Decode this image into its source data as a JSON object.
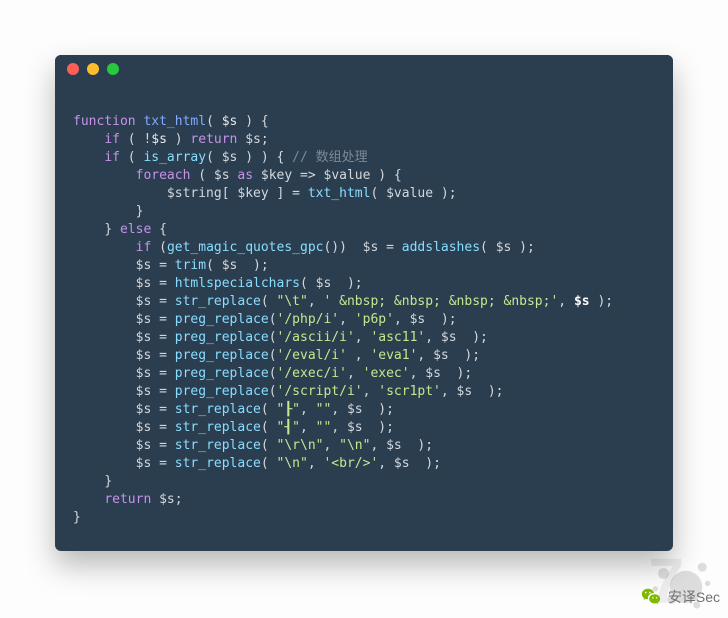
{
  "titlebar": {
    "close": "close",
    "minimize": "minimize",
    "zoom": "zoom"
  },
  "code": {
    "l1": {
      "kw_func": "function",
      "fname": "txt_html",
      "sig_open": "( ",
      "arg": "$s",
      "sig_close": " ) {"
    },
    "l2": {
      "indent": "    ",
      "kw_if": "if",
      "cond_open": " ( !",
      "var": "$s",
      "cond_close": " ) ",
      "kw_ret": "return",
      "ret_tail": " $s;"
    },
    "l3": {
      "indent": "    ",
      "kw_if": "if",
      "open": " ( ",
      "fn": "is_array",
      "args": "( $s ) ) { ",
      "cmt": "// 数组处理"
    },
    "l4": {
      "indent": "        ",
      "kw_foreach": "foreach",
      "open": " ( $s ",
      "kw_as": "as",
      "mid": " $key => $value ) {"
    },
    "l5": {
      "indent": "            ",
      "lhs": "$string[ $key ] = ",
      "fn": "txt_html",
      "args": "( $value );"
    },
    "l6": {
      "indent": "        ",
      "brace": "}"
    },
    "l7": {
      "indent": "    ",
      "brace": "}",
      "sp": " ",
      "kw_else": "else",
      "open": " {"
    },
    "l8": {
      "indent": "        ",
      "kw_if": "if",
      "open": " (",
      "fn": "get_magic_quotes_gpc",
      "args": "())  $s = ",
      "fn2": "addslashes",
      "args2": "( $s );"
    },
    "l9": {
      "indent": "        ",
      "lhs": "$s = ",
      "fn": "trim",
      "args": "( $s  );"
    },
    "l10": {
      "indent": "        ",
      "lhs": "$s = ",
      "fn": "htmlspecialchars",
      "args": "( $s  );"
    },
    "l11": {
      "indent": "        ",
      "lhs": "$s = ",
      "fn": "str_replace",
      "open": "( ",
      "s1": "\"\\t\"",
      "c1": ", ",
      "s2": "' &nbsp; &nbsp; &nbsp; &nbsp;'",
      "c2": ", ",
      "tail": "$s ",
      "close": ");"
    },
    "l12": {
      "indent": "        ",
      "lhs": "$s = ",
      "fn": "preg_replace",
      "open": "(",
      "s1": "'/php/i'",
      "c1": ", ",
      "s2": "'p6p'",
      "c2": ", $s  );"
    },
    "l13": {
      "indent": "        ",
      "lhs": "$s = ",
      "fn": "preg_replace",
      "open": "(",
      "s1": "'/ascii/i'",
      "c1": ", ",
      "s2": "'asc11'",
      "c2": ", $s  );"
    },
    "l14": {
      "indent": "        ",
      "lhs": "$s = ",
      "fn": "preg_replace",
      "open": "(",
      "s1": "'/eval/i'",
      "c1": " , ",
      "s2": "'eva1'",
      "c2": ", $s  );"
    },
    "l15": {
      "indent": "        ",
      "lhs": "$s = ",
      "fn": "preg_replace",
      "open": "(",
      "s1": "'/exec/i'",
      "c1": ", ",
      "s2": "'exec'",
      "c2": ", $s  );"
    },
    "l16": {
      "indent": "        ",
      "lhs": "$s = ",
      "fn": "preg_replace",
      "open": "(",
      "s1": "'/script/i'",
      "c1": ", ",
      "s2": "'scr1pt'",
      "c2": ", $s  );"
    },
    "l17": {
      "indent": "        ",
      "lhs": "$s = ",
      "fn": "str_replace",
      "open": "( ",
      "s1": "\"┠\"",
      "c1": ", ",
      "s2": "\"\"",
      "c2": ", $s  );"
    },
    "l18": {
      "indent": "        ",
      "lhs": "$s = ",
      "fn": "str_replace",
      "open": "( ",
      "s1": "\"┨\"",
      "c1": ", ",
      "s2": "\"\"",
      "c2": ", $s  );"
    },
    "l19": {
      "indent": "        ",
      "lhs": "$s = ",
      "fn": "str_replace",
      "open": "( ",
      "s1": "\"\\r\\n\"",
      "c1": ", ",
      "s2": "\"\\n\"",
      "c2": ", $s  );"
    },
    "l20": {
      "indent": "        ",
      "lhs": "$s = ",
      "fn": "str_replace",
      "open": "( ",
      "s1": "\"\\n\"",
      "c1": ", ",
      "s2": "'<br/>'",
      "c2": ", $s  );"
    },
    "l21": {
      "indent": "    ",
      "brace": "}"
    },
    "l22": {
      "indent": "    ",
      "kw_ret": "return",
      "tail": " $s;"
    },
    "l23": {
      "brace": "}"
    }
  },
  "watermark": {
    "label": "安译Sec"
  }
}
